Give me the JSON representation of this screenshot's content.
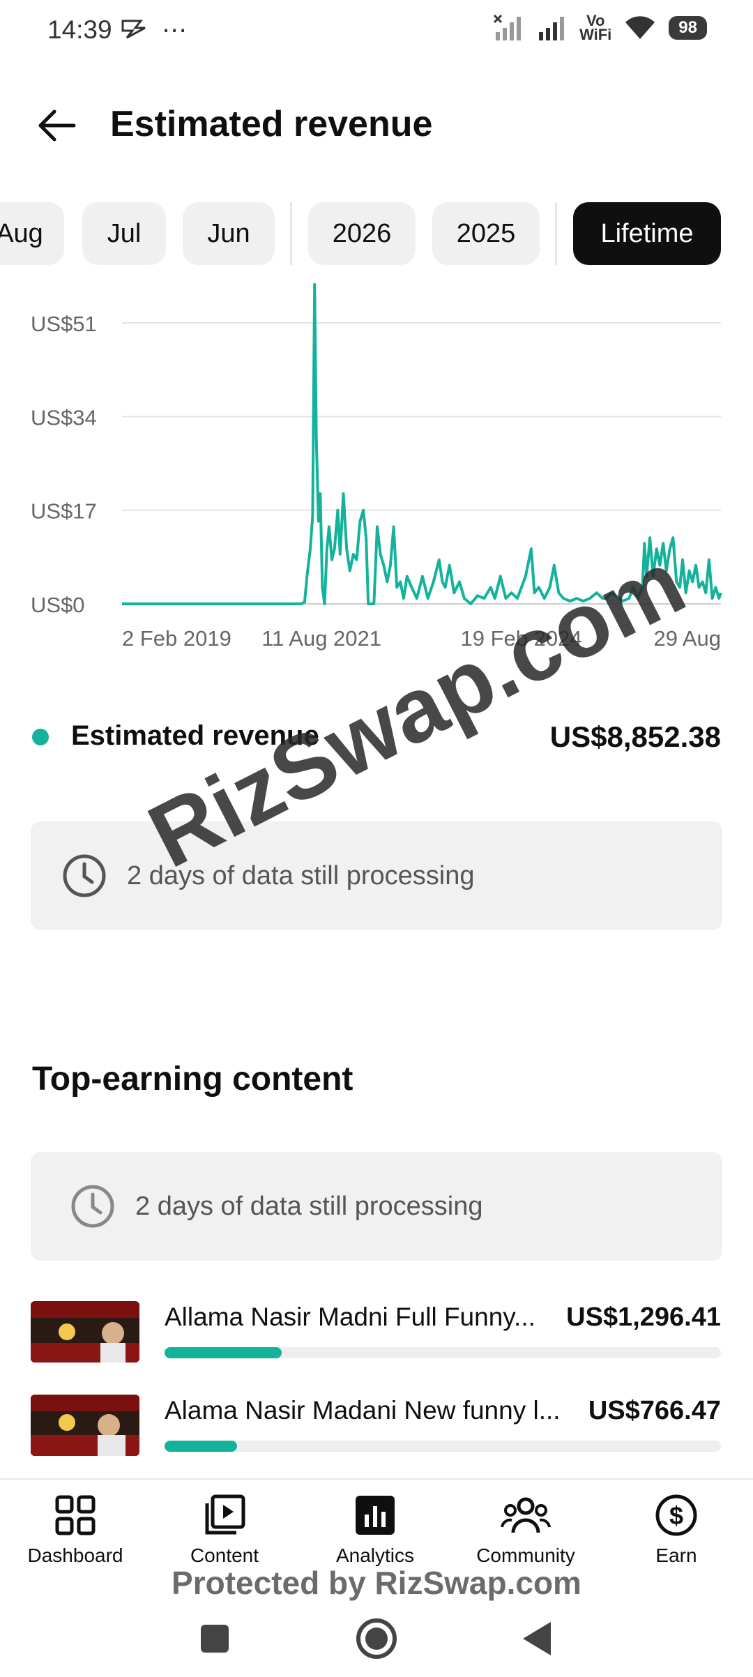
{
  "status_bar": {
    "time": "14:39",
    "battery": "98",
    "vo_label": "Vo",
    "wifi_label": "WiFi"
  },
  "header": {
    "title": "Estimated revenue"
  },
  "filter_chips": [
    {
      "label": "Aug",
      "active": false
    },
    {
      "label": "Jul",
      "active": false
    },
    {
      "label": "Jun",
      "active": false
    },
    {
      "label": "2026",
      "active": false
    },
    {
      "label": "2025",
      "active": false
    },
    {
      "label": "Lifetime",
      "active": true
    }
  ],
  "chart_data": {
    "type": "line",
    "series": [
      {
        "color": "#14b29b",
        "points": [
          [
            "2019-02-02",
            0
          ],
          [
            "2020-02-01",
            0
          ],
          [
            "2020-08-01",
            0
          ],
          [
            "2021-01-20",
            0
          ],
          [
            "2021-05-10",
            0
          ],
          [
            "2021-05-25",
            0.3
          ],
          [
            "2021-06-05",
            5
          ],
          [
            "2021-06-20",
            10
          ],
          [
            "2021-07-01",
            16
          ],
          [
            "2021-07-10",
            58
          ],
          [
            "2021-07-18",
            30
          ],
          [
            "2021-07-28",
            15
          ],
          [
            "2021-08-05",
            20
          ],
          [
            "2021-08-15",
            3
          ],
          [
            "2021-08-25",
            0
          ],
          [
            "2021-09-05",
            10
          ],
          [
            "2021-09-15",
            14
          ],
          [
            "2021-09-28",
            8
          ],
          [
            "2021-10-10",
            10
          ],
          [
            "2021-10-25",
            17
          ],
          [
            "2021-11-05",
            9
          ],
          [
            "2021-11-20",
            20
          ],
          [
            "2021-12-05",
            10
          ],
          [
            "2021-12-20",
            6
          ],
          [
            "2022-01-05",
            9
          ],
          [
            "2022-01-20",
            8
          ],
          [
            "2022-02-05",
            15
          ],
          [
            "2022-02-20",
            17
          ],
          [
            "2022-03-05",
            12
          ],
          [
            "2022-03-15",
            0
          ],
          [
            "2022-04-10",
            0
          ],
          [
            "2022-04-25",
            14
          ],
          [
            "2022-05-10",
            9
          ],
          [
            "2022-05-25",
            7
          ],
          [
            "2022-06-10",
            4
          ],
          [
            "2022-06-25",
            7
          ],
          [
            "2022-07-10",
            14
          ],
          [
            "2022-07-25",
            3
          ],
          [
            "2022-08-10",
            4
          ],
          [
            "2022-08-25",
            1
          ],
          [
            "2022-09-10",
            5
          ],
          [
            "2022-10-01",
            3
          ],
          [
            "2022-10-25",
            1
          ],
          [
            "2022-11-20",
            5
          ],
          [
            "2022-12-15",
            1
          ],
          [
            "2023-01-10",
            4
          ],
          [
            "2023-02-05",
            8
          ],
          [
            "2023-02-20",
            4
          ],
          [
            "2023-03-05",
            3
          ],
          [
            "2023-03-25",
            7
          ],
          [
            "2023-04-15",
            2
          ],
          [
            "2023-05-10",
            4
          ],
          [
            "2023-06-01",
            1
          ],
          [
            "2023-07-01",
            0
          ],
          [
            "2023-08-01",
            1.5
          ],
          [
            "2023-09-01",
            1
          ],
          [
            "2023-10-01",
            3
          ],
          [
            "2023-10-20",
            1
          ],
          [
            "2023-11-15",
            5
          ],
          [
            "2023-12-10",
            1
          ],
          [
            "2024-01-05",
            2
          ],
          [
            "2024-02-01",
            1
          ],
          [
            "2024-02-20",
            3
          ],
          [
            "2024-03-10",
            5
          ],
          [
            "2024-04-05",
            10
          ],
          [
            "2024-04-20",
            2
          ],
          [
            "2024-05-10",
            3
          ],
          [
            "2024-06-05",
            1
          ],
          [
            "2024-06-30",
            3
          ],
          [
            "2024-07-20",
            7
          ],
          [
            "2024-08-10",
            2
          ],
          [
            "2024-09-01",
            1
          ],
          [
            "2024-10-01",
            0.5
          ],
          [
            "2024-11-01",
            1
          ],
          [
            "2024-12-01",
            0.5
          ],
          [
            "2025-01-01",
            1
          ],
          [
            "2025-02-01",
            2
          ],
          [
            "2025-03-01",
            1
          ],
          [
            "2025-03-20",
            1
          ],
          [
            "2025-04-10",
            2
          ],
          [
            "2025-05-01",
            1.5
          ],
          [
            "2025-06-01",
            0.5
          ],
          [
            "2025-07-01",
            1
          ],
          [
            "2025-07-20",
            3
          ],
          [
            "2025-08-10",
            1
          ],
          [
            "2025-09-01",
            3
          ],
          [
            "2025-09-10",
            11
          ],
          [
            "2025-09-20",
            5
          ],
          [
            "2025-10-05",
            12
          ],
          [
            "2025-10-20",
            5
          ],
          [
            "2025-11-05",
            10
          ],
          [
            "2025-11-20",
            7
          ],
          [
            "2025-12-05",
            11
          ],
          [
            "2025-12-20",
            6
          ],
          [
            "2026-01-05",
            10
          ],
          [
            "2026-01-20",
            12
          ],
          [
            "2026-02-05",
            4
          ],
          [
            "2026-02-20",
            3
          ],
          [
            "2026-03-05",
            8
          ],
          [
            "2026-03-20",
            2
          ],
          [
            "2026-04-05",
            6
          ],
          [
            "2026-04-20",
            4
          ],
          [
            "2026-05-05",
            7
          ],
          [
            "2026-05-20",
            3
          ],
          [
            "2026-06-05",
            4
          ],
          [
            "2026-06-20",
            2
          ],
          [
            "2026-07-05",
            8
          ],
          [
            "2026-07-20",
            1
          ],
          [
            "2026-08-05",
            3
          ],
          [
            "2026-08-20",
            1
          ],
          [
            "2026-08-29",
            2
          ]
        ]
      }
    ],
    "y_ticks": [
      "US$0",
      "US$17",
      "US$34",
      "US$51"
    ],
    "y_tick_values": [
      0,
      17,
      34,
      51
    ],
    "ylim": [
      0,
      59
    ],
    "x_ticks": [
      {
        "date": "2019-02-02",
        "label": "2 Feb 2019"
      },
      {
        "date": "2021-08-11",
        "label": "11 Aug 2021"
      },
      {
        "date": "2024-02-19",
        "label": "19 Feb 2024"
      },
      {
        "date": "2026-08-29",
        "label": "29 Aug"
      }
    ],
    "xlim": [
      "2019-02-02",
      "2026-08-29"
    ],
    "grid": true,
    "legend": [
      {
        "label": "Estimated revenue",
        "value": "US$8,852.38"
      }
    ]
  },
  "summary": {
    "label": "Estimated revenue",
    "total": "US$8,852.38",
    "processing_text": "2 days of data still processing"
  },
  "top_earning": {
    "title": "Top-earning content",
    "processing_text": "2 days of data still processing",
    "items": [
      {
        "title": "Allama Nasir Madni Full Funny...",
        "value": "US$1,296.41",
        "share": 0.21
      },
      {
        "title": "Alama Nasir Madani New funny l...",
        "value": "US$766.47",
        "share": 0.13
      }
    ]
  },
  "bottom_nav": [
    {
      "label": "Dashboard",
      "icon": "dashboard-icon"
    },
    {
      "label": "Content",
      "icon": "content-icon"
    },
    {
      "label": "Analytics",
      "icon": "analytics-icon"
    },
    {
      "label": "Community",
      "icon": "community-icon"
    },
    {
      "label": "Earn",
      "icon": "earn-icon"
    }
  ],
  "watermark": {
    "diagonal": "RizSwap.com",
    "bottom": "Protected by RizSwap.com"
  }
}
